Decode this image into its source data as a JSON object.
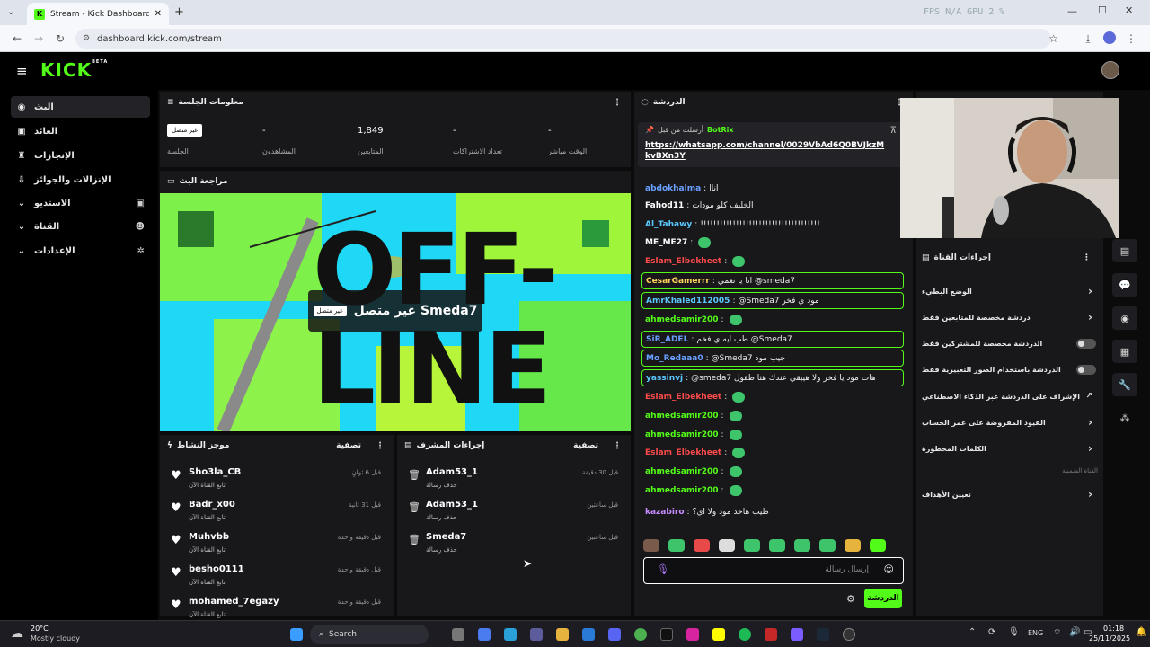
{
  "browser": {
    "tab_title": "Stream - Kick Dashboard",
    "url": "dashboard.kick.com/stream",
    "overlay_stats": "FPS N/A   GPU 2 %"
  },
  "header": {
    "logo": "KICK",
    "logo_badge": "BETA"
  },
  "sidebar": {
    "items": [
      {
        "label": "البث",
        "icon": "broadcast-icon"
      },
      {
        "label": "العائد",
        "icon": "money-icon"
      },
      {
        "label": "الإنجازات",
        "icon": "trophy-icon"
      },
      {
        "label": "الإنزالات والجوائز",
        "icon": "drops-icon"
      },
      {
        "label": "الاستديو",
        "icon": "studio-icon"
      },
      {
        "label": "القناة",
        "icon": "channel-icon"
      },
      {
        "label": "الإعدادات",
        "icon": "gear-icon"
      }
    ]
  },
  "session": {
    "title": "معلومات الجلسة",
    "status_badge": "غير متصل",
    "session_label": "الجلسة",
    "viewers_value": "-",
    "viewers_label": "المشاهدون",
    "followers_value": "1,849",
    "followers_label": "المتابعين",
    "subs_value": "-",
    "subs_label": "تعداد الاشتراكات",
    "live_value": "-",
    "live_label": "الوقت مباشر"
  },
  "preview": {
    "title": "مراجعة البث",
    "offline_text": "OFF-LINE",
    "channel_status": "غير متصل Smeda7",
    "badge": "غير متصل"
  },
  "activity": {
    "title": "موجز النشاط",
    "filter": "تصفية",
    "rows": [
      {
        "name": "Sho3la_CB",
        "sub": "تابع القناة الآن",
        "time": "قبل 6 ثوانٍ"
      },
      {
        "name": "Badr_x00",
        "sub": "تابع القناة الآن",
        "time": "قبل 31 ثانية"
      },
      {
        "name": "Muhvbb",
        "sub": "تابع القناة الآن",
        "time": "قبل دقيقة واحدة"
      },
      {
        "name": "besho0111",
        "sub": "تابع القناة الآن",
        "time": "قبل دقيقة واحدة"
      },
      {
        "name": "mohamed_7egazy",
        "sub": "تابع القناة الآن",
        "time": "قبل دقيقة واحدة"
      }
    ]
  },
  "modactions": {
    "title": "إجراءات المشرف",
    "filter": "تصفية",
    "rows": [
      {
        "name": "Adam53_1",
        "sub": "حذف رسالة",
        "time": "قبل 30 دقيقة"
      },
      {
        "name": "Adam53_1",
        "sub": "حذف رسالة",
        "time": "قبل ساعتين"
      },
      {
        "name": "Smeda7",
        "sub": "حذف رسالة",
        "time": "قبل ساعتين"
      }
    ]
  },
  "chat": {
    "title": "الدردشة",
    "pinned_by": "BotRix",
    "pinned_sent": "أرسلت من قبل",
    "pinned_link": "https://whatsapp.com/channel/0029VbAd6Q0BVJkzMkvBXn3Y",
    "lines": [
      {
        "user": "abdokhalma",
        "color": "#6aa0ff",
        "text": "اناا",
        "hl": false
      },
      {
        "user": "Fahod11",
        "color": "#ffffff",
        "text": "الخليف كلو مودات",
        "hl": false
      },
      {
        "user": "Al_Tahawy",
        "color": "#5ac8ff",
        "text": "!!!!!!!!!!!!!!!!!!!!!!!!!!!!!!!!!!!!!",
        "hl": false
      },
      {
        "user": "ME_ME27",
        "color": "#ffffff",
        "text": "",
        "hl": false
      },
      {
        "user": "Eslam_Elbekheet",
        "color": "#ff4b4b",
        "text": "",
        "hl": false
      },
      {
        "user": "CesarGamerrr",
        "color": "#ffd35a",
        "text": "انا يا نعمي @smeda7",
        "hl": true
      },
      {
        "user": "AmrKhaled112005",
        "color": "#5ac8ff",
        "text": "@Smeda7 مود ي فخر",
        "hl": true
      },
      {
        "user": "ahmedsamir200",
        "color": "#53fc18",
        "text": "",
        "hl": false
      },
      {
        "user": "SiR_ADEL",
        "color": "#6aa0ff",
        "text": "طب ايه ي فخم @Smeda7",
        "hl": true
      },
      {
        "user": "Mo_Redaaa0",
        "color": "#6aa0ff",
        "text": "@Smeda7 جيب مود",
        "hl": true
      },
      {
        "user": "yassinvj",
        "color": "#5ac8ff",
        "text": "@smeda7 هات مود يا فخر ولا هيبقي عندك هنا طقول",
        "hl": true
      },
      {
        "user": "Eslam_Elbekheet",
        "color": "#ff4b4b",
        "text": "",
        "hl": false
      },
      {
        "user": "ahmedsamir200",
        "color": "#53fc18",
        "text": "",
        "hl": false
      },
      {
        "user": "ahmedsamir200",
        "color": "#53fc18",
        "text": "",
        "hl": false
      },
      {
        "user": "Eslam_Elbekheet",
        "color": "#ff4b4b",
        "text": "",
        "hl": false
      },
      {
        "user": "ahmedsamir200",
        "color": "#53fc18",
        "text": "",
        "hl": false
      },
      {
        "user": "ahmedsamir200",
        "color": "#53fc18",
        "text": "",
        "hl": false
      },
      {
        "user": "kazabiro",
        "color": "#c78bff",
        "text": "طيب هاخد مود ولا اي؟",
        "hl": false
      }
    ],
    "input_placeholder": "إرسال رسالة",
    "send_label": "الدردشة"
  },
  "controls": {
    "title": "إجراءات القناة",
    "rows": [
      {
        "label": "الوضع البطيء",
        "kind": "arrow"
      },
      {
        "label": "دردشة مخصصة للمتابعين فقط",
        "kind": "arrow"
      },
      {
        "label": "الدردشة مخصصة للمشتركين فقط",
        "kind": "toggle"
      },
      {
        "label": "الدردشة باستخدام الصور التعبيرية فقط",
        "kind": "toggle"
      },
      {
        "label": "الإشراف على الدردشة عبر الذكاء الاصطناعي",
        "kind": "external"
      },
      {
        "label": "القيود المفروضة على عمر الحساب",
        "kind": "arrow"
      },
      {
        "label": "الكلمات المحظورة",
        "kind": "arrow"
      }
    ],
    "section_label": "القناة الضمنية",
    "goals_label": "تعيين الأهداف"
  },
  "taskbar": {
    "weather_temp": "20°C",
    "weather_desc": "Mostly cloudy",
    "search": "Search",
    "lang": "ENG",
    "time": "01:18",
    "date": "25/11/2025"
  },
  "colors": {
    "accent": "#53fc18",
    "panel": "#18181b",
    "bg": "#000000"
  }
}
